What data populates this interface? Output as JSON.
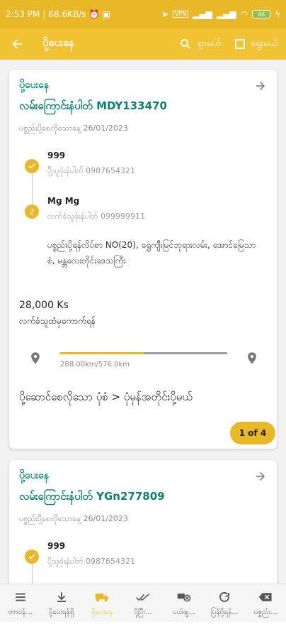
{
  "status_bar": {
    "time": "2:53 PM",
    "speed": "68.6KB/s",
    "battery": "46",
    "vpn": "VPN"
  },
  "app_bar": {
    "title": "ပို့ပေးနေ",
    "search_label": "ရှာမယ်",
    "select_label": "ရွေးမယ်"
  },
  "cards": [
    {
      "status": "ပို့ပေးနေ",
      "code_label": "လမ်းကြောင်းနံပါတ် MDY133470",
      "date": "ပစ္စည်းပို့စေလိုသောနေ့ 26/01/2023",
      "sender_name": "999",
      "sender_phone": "ပို့သူဖုံးနံပါတ် 0987654321",
      "receiver_step": "2",
      "receiver_name": "Mg Mg",
      "receiver_phone": "လက်ခံသူဖုံးနံပါတ် 099999911",
      "receiver_address": "ပစ္စည်းပို့ရန်လိပ်စာ NO(20), ရွှေကျီးမြင်ဘုရားလမ်း, အောင်မြေသာစံ, မန္တလေးတိုင်းဒေသကြီး",
      "price": "28,000 Ks",
      "pay_note": "လက်ခံသူထံမှကောက်ရန်",
      "progress_fraction": 0.5,
      "distance": "288.00km/576.0km",
      "delivery_type": "ပို့ဆောင်စေလိုသော ပုံစံ > ပုံမှန်အတိုင်းပို့မယ်",
      "page_indicator": "1 of 4"
    },
    {
      "status": "ပို့ပေးနေ",
      "code_label": "လမ်းကြောင်းနံပါတ် YGn277809",
      "date": "ပစ္စည်းပို့စေလိုသောနေ့ 26/01/2023",
      "sender_name": "999",
      "sender_phone": "ပို့သူဖုံးနံပါတ် 0987654321"
    }
  ],
  "bottom_nav": [
    {
      "label": "တာဝန်...",
      "icon": "list-icon"
    },
    {
      "label": "ပို့ပေးရန်ရှိ",
      "icon": "download-icon"
    },
    {
      "label": "ပို့ပေးနေ",
      "icon": "truck-icon",
      "active": true
    },
    {
      "label": "ပို့ပြီး...",
      "icon": "double-check-icon"
    },
    {
      "label": "ပယ်ဖျ...",
      "icon": "cancel-truck-icon"
    },
    {
      "label": "ပြန်ပို့ရန်...",
      "icon": "refresh-icon"
    },
    {
      "label": "ပစ္စည်း...",
      "icon": "backspace-x-icon"
    }
  ],
  "colors": {
    "accent": "#e9b829",
    "teal": "#0f7f6e"
  }
}
